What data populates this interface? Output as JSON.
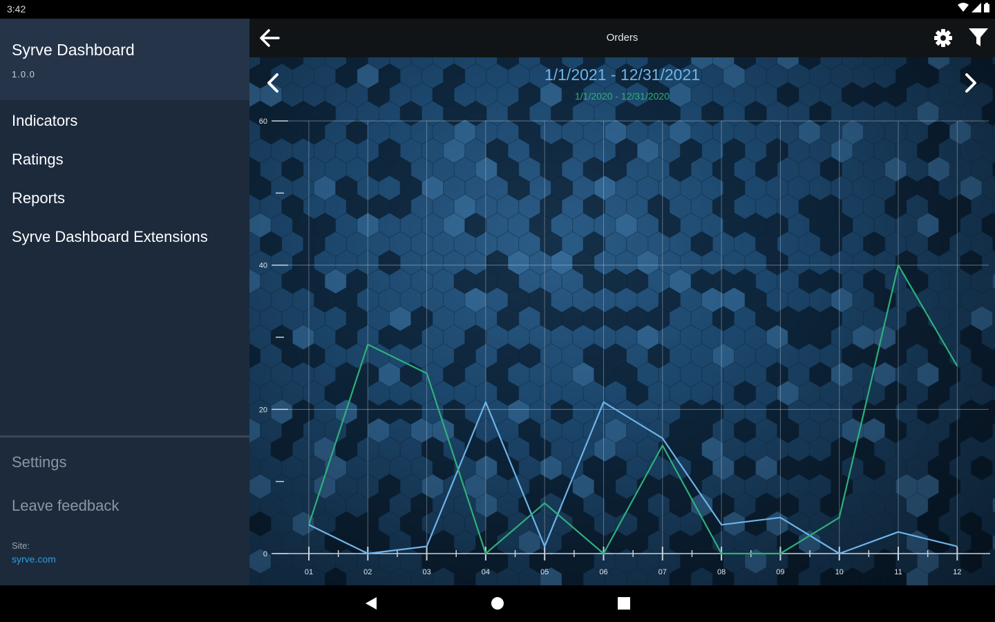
{
  "status": {
    "time": "3:42"
  },
  "drawer": {
    "app_name": "Syrve Dashboard",
    "version": "1.0.0",
    "menu": [
      {
        "label": "Indicators"
      },
      {
        "label": "Ratings"
      },
      {
        "label": "Reports"
      },
      {
        "label": "Syrve Dashboard Extensions"
      }
    ],
    "settings_label": "Settings",
    "feedback_label": "Leave feedback",
    "site_label": "Site:",
    "site_link": "syrve.com"
  },
  "appbar": {
    "title": "Orders"
  },
  "range": {
    "current": "1/1/2021 - 12/31/2021",
    "previous": "1/1/2020 - 12/31/2020"
  },
  "colors": {
    "current_series": "#6fb4ea",
    "previous_series": "#2fb07a"
  },
  "chart_data": {
    "type": "line",
    "x": [
      "01",
      "02",
      "03",
      "04",
      "05",
      "06",
      "07",
      "08",
      "09",
      "10",
      "11",
      "12"
    ],
    "ylim": [
      0,
      60
    ],
    "yticks": [
      "0",
      "20",
      "40",
      "60"
    ],
    "grid": true,
    "series": [
      {
        "values": [
          4,
          0,
          1,
          21,
          1,
          21,
          16,
          4,
          5,
          0,
          3,
          1
        ]
      },
      {
        "values": [
          4,
          29,
          25,
          0,
          7,
          0,
          15,
          0,
          0,
          5,
          40,
          26
        ]
      }
    ]
  }
}
